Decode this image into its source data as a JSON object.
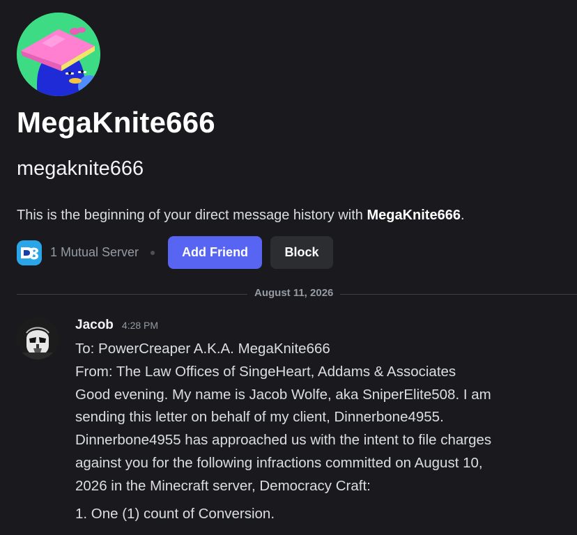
{
  "profile": {
    "display_name": "MegaKnite666",
    "username": "megaknite666",
    "intro_prefix": "This is the beginning of your direct message history with ",
    "intro_name": "MegaKnite666",
    "intro_suffix": "."
  },
  "actions": {
    "mutual_servers": "1 Mutual Server",
    "add_friend": "Add Friend",
    "block": "Block"
  },
  "divider": {
    "date": "August 11, 2026"
  },
  "message": {
    "author": "Jacob",
    "timestamp": "4:28 PM",
    "lines": [
      "To: PowerCreaper A.K.A. MegaKnite666",
      "From: The Law Offices of SingeHeart, Addams & Associates",
      "Good evening. My name is Jacob Wolfe, aka SniperElite508. I am",
      "sending this letter on behalf of my client, Dinnerbone4955.",
      "Dinnerbone4955 has approached us with the intent to file charges",
      "against you for the following infractions committed on August 10,",
      "2026 in the Minecraft server, Democracy Craft:"
    ],
    "list_item": "1. One (1) count of Conversion."
  },
  "colors": {
    "background": "#1a1a1e",
    "accent": "#5865f2",
    "block_button": "#2b2d31",
    "muted_text": "#949ba4",
    "avatar_bg": "#3ddc84"
  },
  "icons": {
    "profile_avatar": "penguin-with-book-avatar",
    "server_icon": "dc-server-icon",
    "message_avatar": "stormtrooper-avatar"
  }
}
